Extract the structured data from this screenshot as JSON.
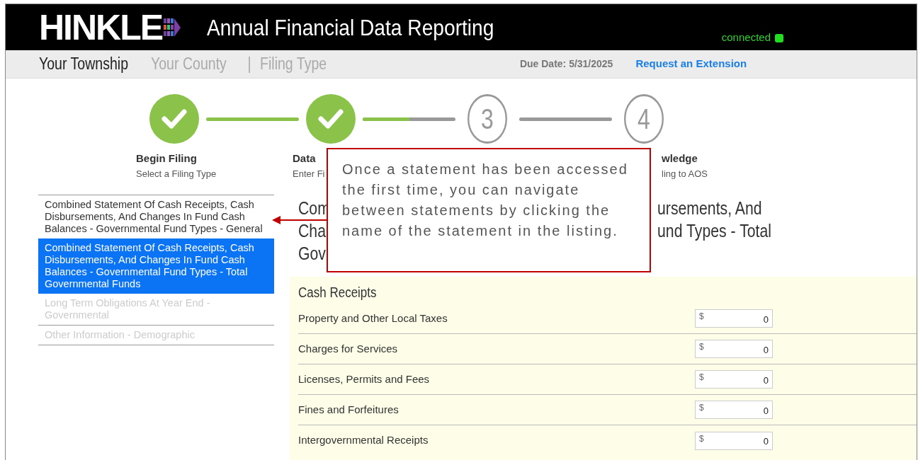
{
  "header": {
    "logo": "HINKLE",
    "title": "Annual Financial Data Reporting",
    "status": {
      "label": "connected",
      "on": true
    }
  },
  "breadcrumb": {
    "items": [
      {
        "label": "Your Township",
        "selected": true
      },
      {
        "label": "Your County",
        "selected": false
      },
      {
        "label": "Filing Type",
        "selected": false
      }
    ],
    "separator": "|",
    "due_date": "Due Date: 5/31/2025",
    "link": "Request an Extension"
  },
  "steps": [
    {
      "kind": "complete",
      "title": "Begin Filing",
      "subtitle": "Select a Filing Type"
    },
    {
      "kind": "complete",
      "title": "Data",
      "subtitle": "Enter Fi"
    },
    {
      "kind": "pending",
      "number": "3"
    },
    {
      "kind": "pending",
      "number": "4",
      "title": "wledge",
      "subtitle": "ling to AOS"
    }
  ],
  "connectors": [
    {
      "level": 1
    },
    {
      "level": 0.5
    },
    {
      "level": 0
    }
  ],
  "sidebar": {
    "items": [
      {
        "label": "Combined Statement Of Cash Receipts, Cash Disbursements, And Changes In Fund Cash Balances - Governmental Fund Types - General",
        "selected": false,
        "disabled": false
      },
      {
        "label": "Combined Statement Of Cash Receipts, Cash Disbursements, And Changes In Fund Cash Balances - Governmental Fund Types - Total Governmental Funds",
        "selected": true,
        "disabled": false
      },
      {
        "label": "Long Term Obligations At Year End - Governmental",
        "selected": false,
        "disabled": true
      },
      {
        "label": "Other Information - Demographic",
        "selected": false,
        "disabled": true
      }
    ]
  },
  "heading": {
    "lines": [
      {
        "left": "Com",
        "right": "ursements, And"
      },
      {
        "left": "Cha",
        "right": "und Types - Total"
      },
      {
        "left": "Gov"
      }
    ]
  },
  "section": {
    "title": "Cash Receipts",
    "rows": [
      {
        "label": "Property and Other Local Taxes",
        "currency": "$",
        "value": "0"
      },
      {
        "label": "Charges for Services",
        "currency": "$",
        "value": "0"
      },
      {
        "label": "Licenses, Permits and Fees",
        "currency": "$",
        "value": "0"
      },
      {
        "label": "Fines and Forfeitures",
        "currency": "$",
        "value": "0"
      },
      {
        "label": "Intergovernmental Receipts",
        "currency": "$",
        "value": "0"
      }
    ]
  },
  "callout": {
    "text": "Once a statement has been accessed the first time, you can navigate between statements by clicking the name of the statement in the listing."
  }
}
